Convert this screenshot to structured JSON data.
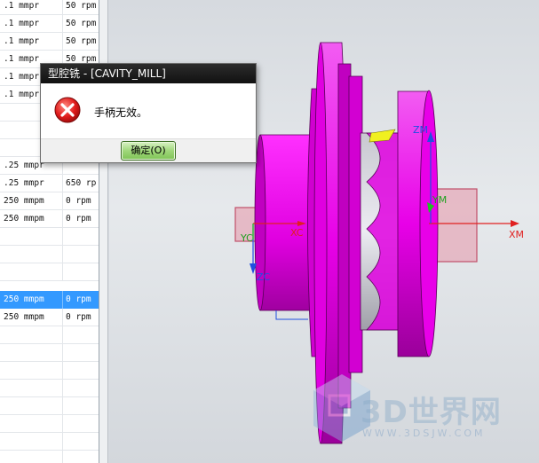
{
  "operations_table": {
    "rows": [
      {
        "feed": ".1 mmpr",
        "speed": "50 rpm",
        "selected": false
      },
      {
        "feed": ".1 mmpr",
        "speed": "50 rpm",
        "selected": false
      },
      {
        "feed": ".1 mmpr",
        "speed": "50 rpm",
        "selected": false
      },
      {
        "feed": ".1 mmpr",
        "speed": "50 rpm",
        "selected": false
      },
      {
        "feed": ".1 mmpr",
        "speed": "",
        "selected": false
      },
      {
        "feed": ".1 mmpr",
        "speed": "",
        "selected": false
      },
      {
        "feed": "",
        "speed": "",
        "selected": false
      },
      {
        "feed": "",
        "speed": "",
        "selected": false
      },
      {
        "feed": "",
        "speed": "",
        "selected": false
      },
      {
        "feed": ".25 mmpr",
        "speed": "",
        "selected": false
      },
      {
        "feed": ".25 mmpr",
        "speed": "650 rp",
        "selected": false
      },
      {
        "feed": "250 mmpm",
        "speed": "0 rpm",
        "selected": false
      },
      {
        "feed": "250 mmpm",
        "speed": "0 rpm",
        "selected": false
      },
      {
        "feed": "",
        "speed": "",
        "selected": false
      },
      {
        "feed": "",
        "speed": "",
        "selected": false
      },
      {
        "feed": "",
        "speed": "",
        "selected": false
      },
      {
        "feed": "250 mmpm",
        "speed": "0 rpm",
        "selected": true
      },
      {
        "feed": "250 mmpm",
        "speed": "0 rpm",
        "selected": false
      },
      {
        "feed": "",
        "speed": "",
        "selected": false
      },
      {
        "feed": "",
        "speed": "",
        "selected": false
      },
      {
        "feed": "",
        "speed": "",
        "selected": false
      },
      {
        "feed": "",
        "speed": "",
        "selected": false
      },
      {
        "feed": "",
        "speed": "",
        "selected": false
      },
      {
        "feed": "",
        "speed": "",
        "selected": false
      },
      {
        "feed": "",
        "speed": "",
        "selected": false
      },
      {
        "feed": "",
        "speed": "",
        "selected": false
      }
    ]
  },
  "dialog": {
    "title": "型腔铣 - [CAVITY_MILL]",
    "message": "手柄无效。",
    "ok_label": "确定(O)",
    "icon": "error-icon"
  },
  "viewport": {
    "axis_labels": {
      "xm": "XM",
      "ym": "YM",
      "zm": "ZM",
      "xc": "XC",
      "yc": "YC",
      "zc": "ZC"
    },
    "colors": {
      "part": "#e800e8",
      "part_dark": "#7a007a",
      "blank": "#e6a6b6",
      "axis_red": "#e02020",
      "axis_blue": "#2050e0",
      "highlight": "#f0f020"
    }
  },
  "watermark": {
    "text": "3D世界网",
    "url": "WWW.3DSJW.COM"
  }
}
